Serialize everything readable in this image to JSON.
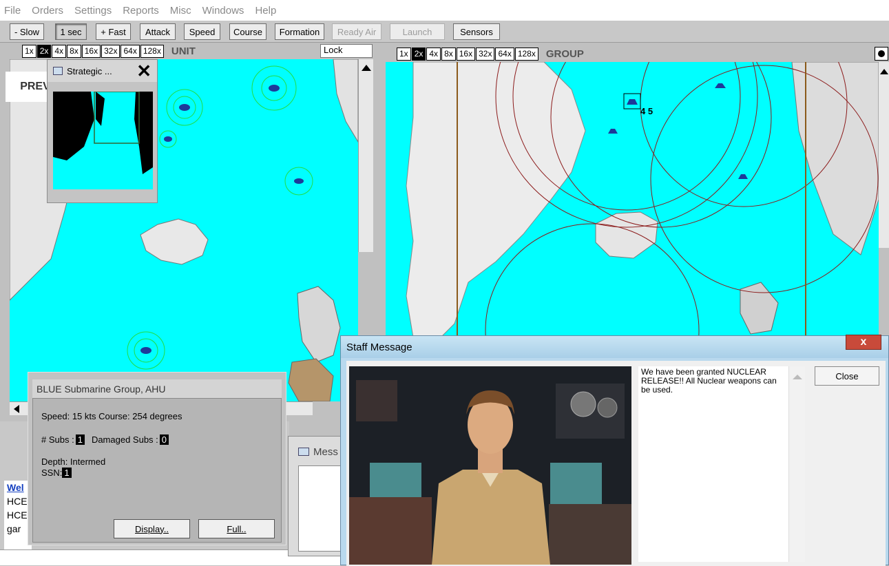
{
  "menu": [
    "File",
    "Orders",
    "Settings",
    "Reports",
    "Misc",
    "Windows",
    "Help"
  ],
  "toolbar": {
    "slow": "- Slow",
    "onesec": "1 sec",
    "fast": "+ Fast",
    "attack": "Attack",
    "speed": "Speed",
    "course": "Course",
    "formation": "Formation",
    "ready_air": "Ready Air",
    "launch": "Launch",
    "sensors": "Sensors"
  },
  "zooms": [
    "1x",
    "2x",
    "4x",
    "8x",
    "16x",
    "32x",
    "64x",
    "128x"
  ],
  "left_view": {
    "title": "UNIT",
    "lock_value": "Lock",
    "prev": "PREV"
  },
  "right_view": {
    "title": "GROUP"
  },
  "strategic": {
    "title": "Strategic ..."
  },
  "unit_info": {
    "title": "BLUE Submarine Group, AHU",
    "speed_course": "Speed: 15 kts  Course: 254 degrees",
    "subs_label": "# Subs :",
    "subs_value": "1",
    "damaged_label": "Damaged Subs :",
    "damaged_value": "0",
    "depth": "Depth: Intermed",
    "ssn_label": "SSN:",
    "ssn_value": "1",
    "display_btn": "Display..",
    "full_btn": "Full.."
  },
  "messages_window": {
    "title": "Mess"
  },
  "log_lines": [
    "Wel",
    "HCE",
    "HCE",
    "gar"
  ],
  "staff": {
    "title": "Staff Message",
    "message": "We have been granted NUCLEAR RELEASE!!  All Nuclear weapons can be used.",
    "close": "Close",
    "x": "x"
  },
  "map_labels": {
    "track": "4 5"
  },
  "colors": {
    "sea": "#00ffff",
    "range_ring": "#8b1a1a",
    "detect_ring": "#22dd44",
    "titlebar": "#a9cfe8"
  }
}
